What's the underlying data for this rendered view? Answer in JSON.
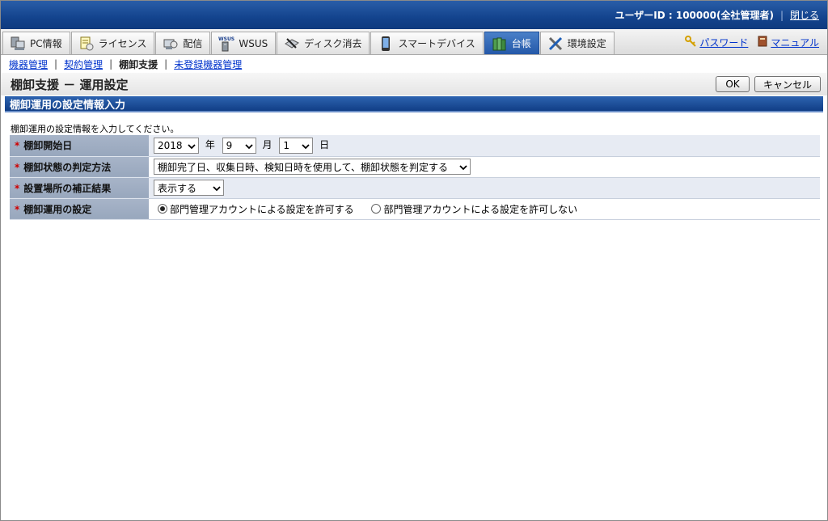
{
  "header": {
    "user_text": "ユーザーID : 100000(全社管理者)",
    "close_label": "閉じる"
  },
  "nav": {
    "tabs": [
      {
        "label": "PC情報",
        "icon": "pc-icon"
      },
      {
        "label": "ライセンス",
        "icon": "license-icon"
      },
      {
        "label": "配信",
        "icon": "delivery-icon"
      },
      {
        "label": "WSUS",
        "icon": "wsus-icon"
      },
      {
        "label": "ディスク消去",
        "icon": "disk-erase-icon"
      },
      {
        "label": "スマートデバイス",
        "icon": "smart-device-icon"
      },
      {
        "label": "台帳",
        "icon": "ledger-icon"
      },
      {
        "label": "環境設定",
        "icon": "settings-tools-icon"
      }
    ],
    "password_label": "パスワード",
    "manual_label": "マニュアル"
  },
  "subnav": {
    "items": [
      "機器管理",
      "契約管理",
      "棚卸支援",
      "未登録機器管理"
    ]
  },
  "page": {
    "title": "棚卸支援 － 運用設定",
    "ok_label": "OK",
    "cancel_label": "キャンセル"
  },
  "section": {
    "title": "棚卸運用の設定情報入力",
    "description": "棚卸運用の設定情報を入力してください。"
  },
  "form": {
    "required_mark": "*",
    "start_date": {
      "label": "棚卸開始日",
      "year": "2018",
      "year_unit": "年",
      "month": "9",
      "month_unit": "月",
      "day": "1",
      "day_unit": "日"
    },
    "judgement": {
      "label": "棚卸状態の判定方法",
      "value": "棚卸完了日、収集日時、検知日時を使用して、棚卸状態を判定する"
    },
    "location": {
      "label": "設置場所の補正結果",
      "value": "表示する"
    },
    "operation": {
      "label": "棚卸運用の設定",
      "option_allow": "部門管理アカウントによる設定を許可する",
      "option_deny": "部門管理アカウントによる設定を許可しない",
      "selected": "allow"
    }
  }
}
